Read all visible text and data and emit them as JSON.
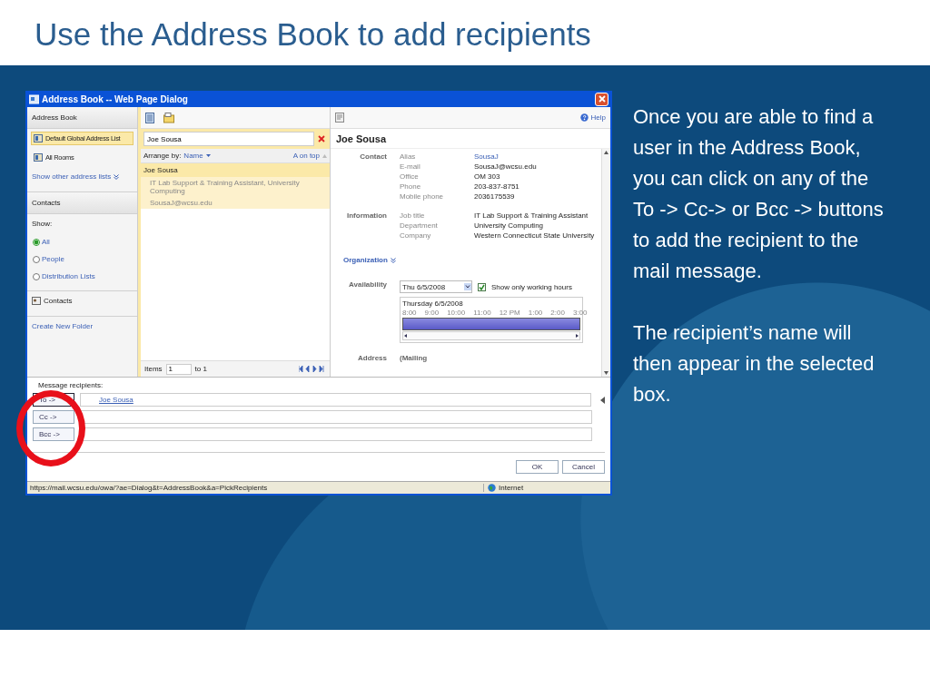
{
  "slide": {
    "title": "Use the Address Book to add recipients",
    "paragraphs": [
      "Once you are able to find a user in the Address Book, you can click on any of the To -> Cc-> or Bcc -> buttons to add the recipient to the mail message.",
      "The recipient’s name will then appear in the selected box."
    ]
  },
  "dialog": {
    "title": "Address Book -- Web Page Dialog",
    "nav": {
      "header": "Address Book",
      "lists": [
        {
          "label": "Default Global Address List",
          "selected": true
        },
        {
          "label": "All Rooms",
          "selected": false
        }
      ],
      "more_link": "Show other address lists",
      "contacts_header": "Contacts",
      "show_label": "Show:",
      "filters": [
        {
          "label": "All",
          "selected": true
        },
        {
          "label": "People",
          "selected": false
        },
        {
          "label": "Distribution Lists",
          "selected": false
        }
      ],
      "folders": [
        "Contacts"
      ],
      "create_link": "Create New Folder"
    },
    "list": {
      "search": "Joe Sousa",
      "arrange_label": "Arrange by:",
      "arrange_value": "Name",
      "sort": "A on top",
      "results": [
        {
          "name": "Joe Sousa",
          "lines": [
            "IT Lab Support & Training Assistant, University Computing",
            "SousaJ@wcsu.edu"
          ],
          "selected": true
        }
      ],
      "items_label": "Items",
      "items_value": "1",
      "items_to": "to 1"
    },
    "details": {
      "help": "Help",
      "name": "Joe Sousa",
      "sections": [
        {
          "heading": "Contact",
          "fields": [
            {
              "label": "Alias",
              "value": "SousaJ",
              "kind": "link"
            },
            {
              "label": "E-mail",
              "value": "SousaJ@wcsu.edu",
              "kind": "text"
            },
            {
              "label": "Office",
              "value": "OM 303",
              "kind": "text"
            },
            {
              "label": "Phone",
              "value": "203-837-8751",
              "kind": "text"
            },
            {
              "label": "Mobile phone",
              "value": "2036175539",
              "kind": "text"
            }
          ]
        },
        {
          "heading": "Information",
          "fields": [
            {
              "label": "Job title",
              "value": "IT Lab Support & Training Assistant",
              "kind": "text"
            },
            {
              "label": "Department",
              "value": "University Computing",
              "kind": "text"
            },
            {
              "label": "Company",
              "value": "Western Connecticut State University",
              "kind": "text"
            }
          ]
        }
      ],
      "organization": "Organization",
      "availability": {
        "heading": "Availability",
        "date": "Thu 6/5/2008",
        "working_hours": {
          "label": "Show only working hours",
          "checked": true
        },
        "day": "Thursday 6/5/2008",
        "hours": [
          "8:00",
          "9:00",
          "10:00",
          "11:00",
          "12 PM",
          "1:00",
          "2:00",
          "3:00"
        ]
      },
      "address": {
        "heading": "Address",
        "value": "(Mailing"
      }
    },
    "recipients": {
      "label": "Message recipients:",
      "rows": [
        {
          "button": "To ->",
          "selected": true,
          "names": [
            "Joe Sousa"
          ]
        },
        {
          "button": "Cc ->",
          "selected": false
        },
        {
          "button": "Bcc ->",
          "selected": false
        }
      ]
    },
    "buttons": [
      "OK",
      "Cancel"
    ],
    "status": {
      "url": "https://mail.wcsu.edu/owa/?ae=Dialog&t=AddressBook&a=PickRecipients",
      "zone": "Internet"
    }
  }
}
